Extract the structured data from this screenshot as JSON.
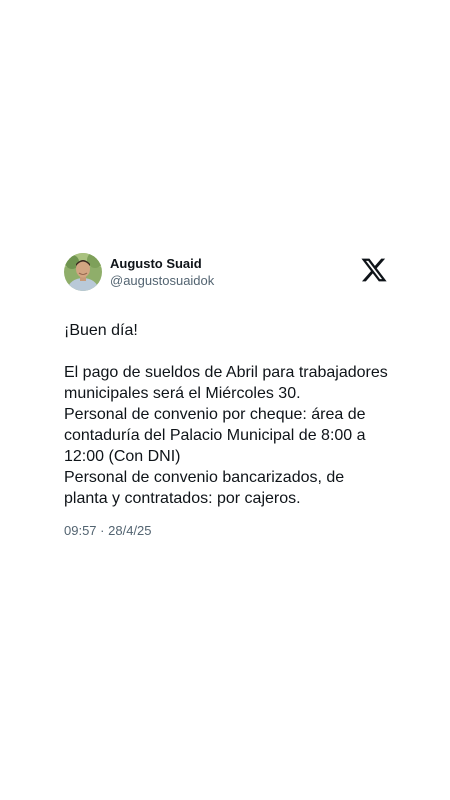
{
  "author": {
    "name": "Augusto Suaid",
    "handle": "@augustosuaidok",
    "avatar_icon": "profile-photo-icon"
  },
  "brand": {
    "icon": "x-logo-icon",
    "color": "#0f1419"
  },
  "tweet": {
    "lines": [
      "¡Buen día!",
      "",
      "El pago de sueldos de Abril para trabajadores municipales será el Miércoles 30.",
      "Personal de convenio por cheque: área de contaduría del Palacio Municipal de 8:00 a 12:00 (Con DNI)",
      "Personal de convenio bancarizados, de planta y contratados: por cajeros."
    ],
    "time": "09:57",
    "separator": "·",
    "date": "28/4/25"
  },
  "colors": {
    "text": "#0f1419",
    "secondary_text": "#536471",
    "background": "#ffffff"
  }
}
